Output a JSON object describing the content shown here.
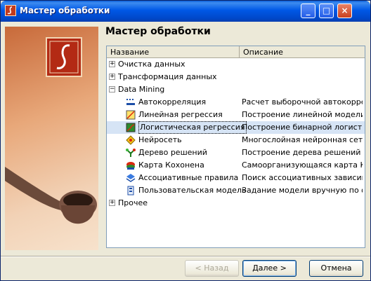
{
  "window": {
    "title": "Мастер обработки"
  },
  "heading": "Мастер обработки",
  "list": {
    "columns": [
      "Название",
      "Описание"
    ],
    "rows": [
      {
        "name": "Очистка данных",
        "desc": "",
        "icon": "expand-plus-icon"
      },
      {
        "name": "Трансформация данных",
        "desc": "",
        "icon": "expand-plus-icon"
      },
      {
        "name": "Data Mining",
        "desc": "",
        "icon": "collapse-minus-icon"
      },
      {
        "name": "Автокорреляция",
        "desc": "Расчет выборочной автокоррел...",
        "icon": "autocorrelation-icon"
      },
      {
        "name": "Линейная регрессия",
        "desc": "Построение линейной модели",
        "icon": "linear-regression-icon"
      },
      {
        "name": "Логистическая регрессия",
        "desc": "Построение бинарной логистич...",
        "icon": "logistic-regression-icon"
      },
      {
        "name": "Нейросеть",
        "desc": "Многослойная нейронная сеть",
        "icon": "neural-network-icon"
      },
      {
        "name": "Дерево решений",
        "desc": "Построение дерева решений ал...",
        "icon": "decision-tree-icon"
      },
      {
        "name": "Карта Кохонена",
        "desc": "Самоорганизующаяся карта Ко...",
        "icon": "kohonen-map-icon"
      },
      {
        "name": "Ассоциативные правила",
        "desc": "Поиск ассоциативных зависим...",
        "icon": "association-rules-icon"
      },
      {
        "name": "Пользовательская модель",
        "desc": "Задание модели вручную по фо...",
        "icon": "custom-model-icon"
      },
      {
        "name": "Прочее",
        "desc": "",
        "icon": "expand-plus-icon"
      }
    ],
    "selected_row": "Логистическая регрессия"
  },
  "buttons": {
    "back": "< Назад",
    "next": "Далее >",
    "cancel": "Отмена"
  },
  "titlebar_buttons": {
    "minimize": "_",
    "maximize": "□",
    "close": "×"
  },
  "expander_glyphs": {
    "plus": "+",
    "minus": "−"
  },
  "colors": {
    "selection": "#d6e4f5",
    "titlebar": "#0058e6",
    "logo": "#b32a14"
  }
}
